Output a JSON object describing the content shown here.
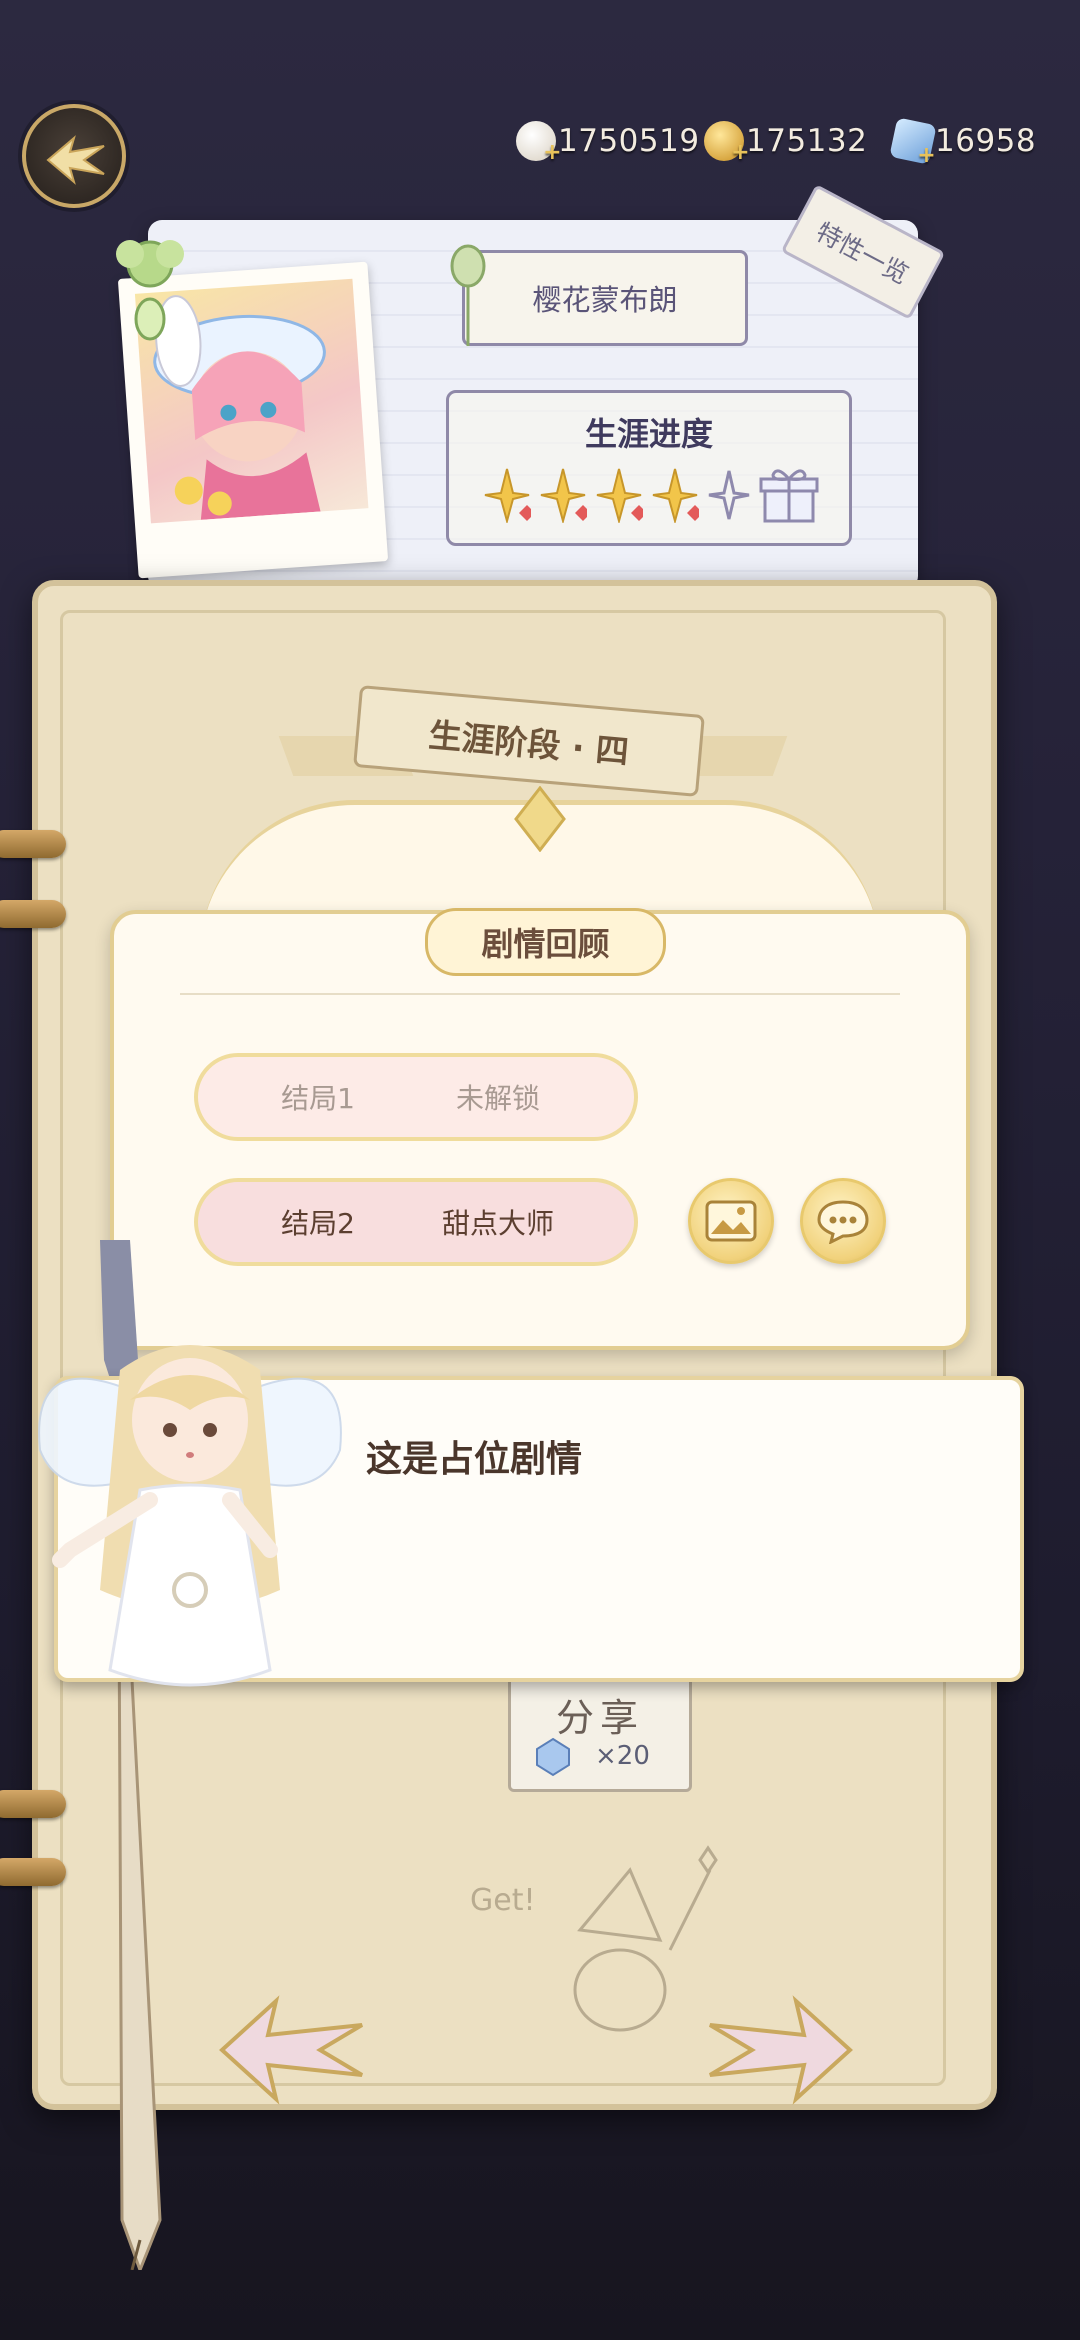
{
  "hud": {
    "currencies": [
      {
        "name": "shell-currency",
        "value": "1750519",
        "color": "#f2e8d8"
      },
      {
        "name": "gold-coin",
        "value": "175132",
        "color": "#e7b845"
      },
      {
        "name": "crystal",
        "value": "16958",
        "color": "#8ab6e8"
      }
    ]
  },
  "profile": {
    "character_name": "樱花蒙布朗",
    "trait_tab": "特性一览",
    "career_title": "生涯进度",
    "stars_filled": 4
  },
  "stage": {
    "title": "生涯阶段 · 四"
  },
  "review": {
    "title": "剧情回顾",
    "endings": [
      {
        "label": "结局1",
        "value": "未解锁"
      },
      {
        "label": "结局2",
        "value": "甜点大师"
      }
    ]
  },
  "dialogue": {
    "text": "这是占位剧情"
  },
  "share": {
    "label": "分享",
    "count": "×20"
  },
  "colors": {
    "accent_gold": "#e2cd92",
    "paper": "#ece0c2"
  }
}
